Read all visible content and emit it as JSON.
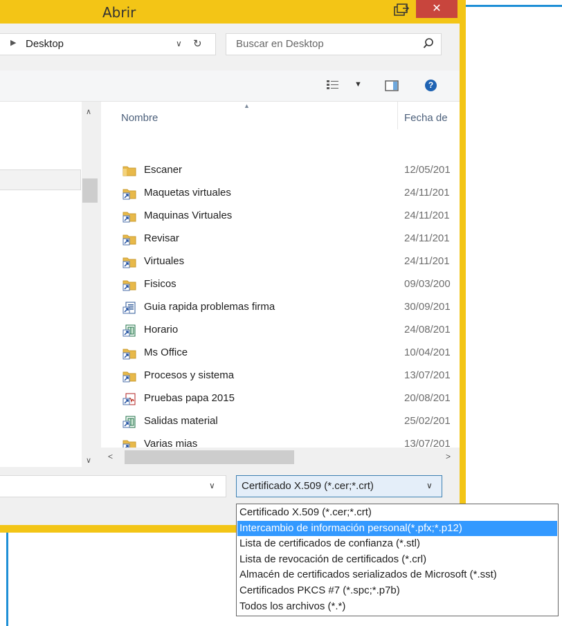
{
  "dialog": {
    "title": "Abrir",
    "close_glyph": "✕"
  },
  "address": {
    "path": "Desktop",
    "search_placeholder": "Buscar en Desktop"
  },
  "columns": {
    "name": "Nombre",
    "date": "Fecha de"
  },
  "files": [
    {
      "name": "Escaner",
      "date": "12/05/201",
      "icon": "folder-icon"
    },
    {
      "name": "Maquetas virtuales",
      "date": "24/11/201",
      "icon": "shortcut-icon"
    },
    {
      "name": "Maquinas Virtuales",
      "date": "24/11/201",
      "icon": "shortcut-icon"
    },
    {
      "name": "Revisar",
      "date": "24/11/201",
      "icon": "shortcut-icon"
    },
    {
      "name": "Virtuales",
      "date": "24/11/201",
      "icon": "shortcut-icon"
    },
    {
      "name": "Fisicos",
      "date": "09/03/200",
      "icon": "shortcut-icon"
    },
    {
      "name": "Guia rapida problemas firma",
      "date": "30/09/201",
      "icon": "document-shortcut-icon"
    },
    {
      "name": "Horario",
      "date": "24/08/201",
      "icon": "spreadsheet-shortcut-icon"
    },
    {
      "name": "Ms Office",
      "date": "10/04/201",
      "icon": "shortcut-icon"
    },
    {
      "name": "Procesos y sistema",
      "date": "13/07/201",
      "icon": "shortcut-icon"
    },
    {
      "name": "Pruebas papa 2015",
      "date": "20/08/201",
      "icon": "pdf-shortcut-icon"
    },
    {
      "name": "Salidas material",
      "date": "25/02/201",
      "icon": "spreadsheet-shortcut-icon"
    },
    {
      "name": "Varias mias",
      "date": "13/07/201",
      "icon": "shortcut-icon"
    }
  ],
  "file_type": {
    "selected": "Certificado X.509 (*.cer;*.crt)",
    "options": [
      "Certificado X.509 (*.cer;*.crt)",
      "Intercambio de información personal(*.pfx;*.p12)",
      "Lista de certificados de confianza (*.stl)",
      "Lista de revocación de certificados (*.crl)",
      "Almacén de certificados serializados de Microsoft (*.sst)",
      "Certificados PKCS #7 (*.spc;*.p7b)",
      "Todos los archivos (*.*)"
    ],
    "highlighted_index": 1
  },
  "colors": {
    "title_bar": "#f3c516",
    "close_button": "#c8453d",
    "selection": "#3399ff",
    "frame": "#1e8fd6"
  }
}
